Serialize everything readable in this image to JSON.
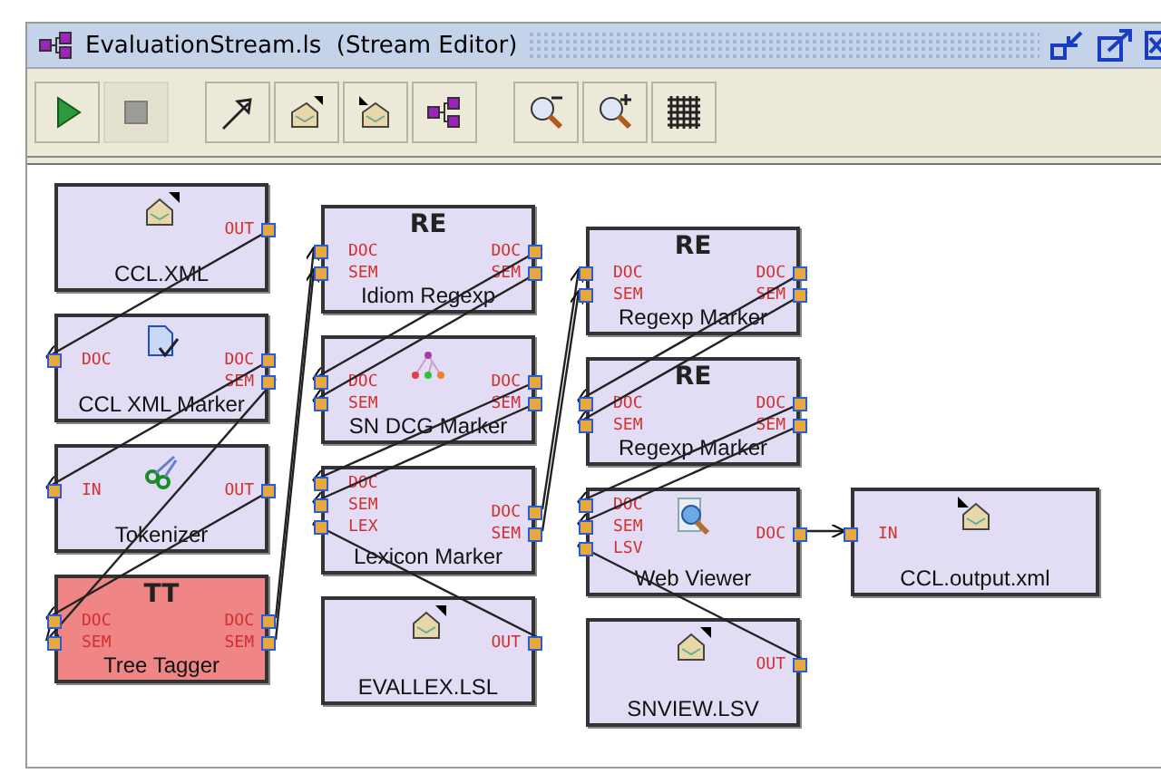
{
  "window": {
    "title": "EvaluationStream.ls  (Stream Editor)"
  },
  "toolbar": [
    [
      {
        "kind": "play",
        "disabled": false
      },
      {
        "kind": "stop",
        "disabled": true
      }
    ],
    [
      {
        "kind": "connect",
        "disabled": false
      },
      {
        "kind": "import",
        "disabled": false
      },
      {
        "kind": "export",
        "disabled": false
      },
      {
        "kind": "stream",
        "disabled": false
      }
    ],
    [
      {
        "kind": "zoom-out",
        "disabled": false
      },
      {
        "kind": "zoom-in",
        "disabled": false
      },
      {
        "kind": "grid",
        "disabled": false
      }
    ]
  ],
  "nodes": [
    {
      "title": "CCL.XML",
      "kind": "source",
      "selected": false,
      "outputs": [
        {
          "label": "OUT",
          "connected": true
        }
      ]
    },
    {
      "title": "CCL XML Marker",
      "kind": "marker",
      "selected": false,
      "inputs": [
        {
          "label": "DOC",
          "connected": true
        }
      ],
      "outputs": [
        {
          "label": "DOC",
          "connected": true
        },
        {
          "label": "SEM",
          "connected": true
        }
      ]
    },
    {
      "title": "Tokenizer",
      "kind": "scissors",
      "selected": false,
      "inputs": [
        {
          "label": "IN",
          "connected": true
        }
      ],
      "outputs": [
        {
          "label": "OUT",
          "connected": true
        }
      ]
    },
    {
      "title": "Tree Tagger",
      "kind": "text",
      "badge": "TT",
      "selected": true,
      "inputs": [
        {
          "label": "DOC",
          "connected": true
        },
        {
          "label": "SEM",
          "connected": true
        }
      ],
      "outputs": [
        {
          "label": "DOC",
          "connected": true
        },
        {
          "label": "SEM",
          "connected": true
        }
      ]
    },
    {
      "title": "Idiom Regexp",
      "kind": "text",
      "badge": "RE",
      "selected": false,
      "inputs": [
        {
          "label": "DOC",
          "connected": true
        },
        {
          "label": "SEM",
          "connected": true
        }
      ],
      "outputs": [
        {
          "label": "DOC",
          "connected": true
        },
        {
          "label": "SEM",
          "connected": true
        }
      ]
    },
    {
      "title": "SN DCG Marker",
      "kind": "tree",
      "selected": false,
      "inputs": [
        {
          "label": "DOC",
          "connected": true
        },
        {
          "label": "SEM",
          "connected": true
        }
      ],
      "outputs": [
        {
          "label": "DOC",
          "connected": true
        },
        {
          "label": "SEM",
          "connected": true
        }
      ]
    },
    {
      "title": "Lexicon Marker",
      "kind": "plain",
      "selected": false,
      "inputs": [
        {
          "label": "DOC",
          "connected": true
        },
        {
          "label": "SEM",
          "connected": true
        },
        {
          "label": "LEX",
          "connected": true
        }
      ],
      "outputs": [
        {
          "label": "DOC",
          "connected": true
        },
        {
          "label": "SEM",
          "connected": true
        }
      ]
    },
    {
      "title": "EVALLEX.LSL",
      "kind": "source",
      "selected": false,
      "outputs": [
        {
          "label": "OUT",
          "connected": true
        }
      ]
    },
    {
      "title": "Regexp Marker",
      "kind": "text",
      "badge": "RE",
      "selected": false,
      "inputs": [
        {
          "label": "DOC",
          "connected": true
        },
        {
          "label": "SEM",
          "connected": true
        }
      ],
      "outputs": [
        {
          "label": "DOC",
          "connected": true
        },
        {
          "label": "SEM",
          "connected": true
        }
      ]
    },
    {
      "title": "Regexp Marker",
      "kind": "text",
      "badge": "RE",
      "selected": false,
      "inputs": [
        {
          "label": "DOC",
          "connected": true
        },
        {
          "label": "SEM",
          "connected": true
        }
      ],
      "outputs": [
        {
          "label": "DOC",
          "connected": true
        },
        {
          "label": "SEM",
          "connected": true
        }
      ]
    },
    {
      "title": "Web Viewer",
      "kind": "viewer",
      "selected": false,
      "inputs": [
        {
          "label": "DOC",
          "connected": true
        },
        {
          "label": "SEM",
          "connected": true
        },
        {
          "label": "LSV",
          "connected": true
        }
      ],
      "outputs": [
        {
          "label": "DOC",
          "connected": true
        }
      ]
    },
    {
      "title": "SNVIEW.LSV",
      "kind": "source",
      "selected": false,
      "outputs": [
        {
          "label": "OUT",
          "connected": true
        }
      ]
    },
    {
      "title": "CCL.output.xml",
      "kind": "sink",
      "selected": false,
      "inputs": [
        {
          "label": "IN",
          "connected": true
        }
      ]
    }
  ]
}
